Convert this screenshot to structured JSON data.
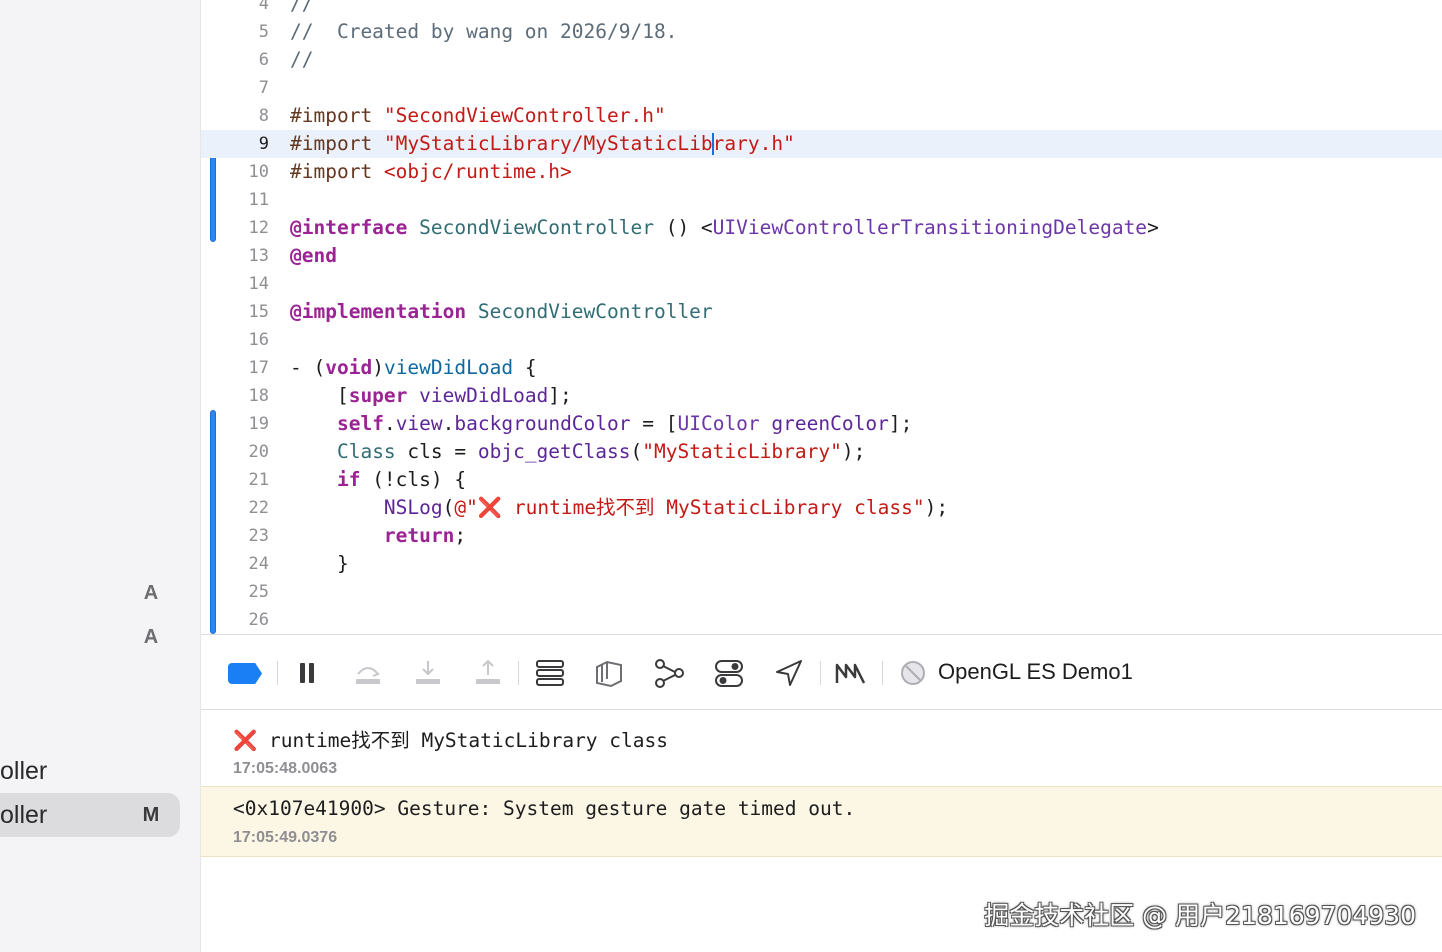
{
  "sidebar": {
    "badges": [
      "A",
      "A"
    ],
    "files": [
      {
        "name": "oller",
        "status": "",
        "selected": false
      },
      {
        "name": "oller",
        "status": "M",
        "selected": true
      }
    ]
  },
  "editor": {
    "current_line": 9,
    "lines": [
      {
        "n": "4",
        "segs": [
          {
            "t": "//",
            "c": "comment"
          }
        ]
      },
      {
        "n": "5",
        "segs": [
          {
            "t": "//  Created by wang on 2026/9/18.",
            "c": "comment"
          }
        ]
      },
      {
        "n": "6",
        "segs": [
          {
            "t": "//",
            "c": "comment"
          }
        ]
      },
      {
        "n": "7",
        "segs": []
      },
      {
        "n": "8",
        "segs": [
          {
            "t": "#import ",
            "c": "preproc"
          },
          {
            "t": "\"SecondViewController.h\"",
            "c": "string"
          }
        ]
      },
      {
        "n": "9",
        "segs": [
          {
            "t": "#import ",
            "c": "preproc"
          },
          {
            "t": "\"MyStaticLibrary/MyStaticLibrary.h\"",
            "c": "string"
          }
        ]
      },
      {
        "n": "10",
        "segs": [
          {
            "t": "#import ",
            "c": "preproc"
          },
          {
            "t": "<objc/runtime.h>",
            "c": "string"
          }
        ]
      },
      {
        "n": "11",
        "segs": []
      },
      {
        "n": "12",
        "segs": [
          {
            "t": "@interface",
            "c": "keyword"
          },
          {
            "t": " ",
            "c": "plain"
          },
          {
            "t": "SecondViewController",
            "c": "typedecl"
          },
          {
            "t": " () <",
            "c": "plain"
          },
          {
            "t": "UIViewControllerTransitioningDelegate",
            "c": "sdktype"
          },
          {
            "t": ">",
            "c": "plain"
          }
        ]
      },
      {
        "n": "13",
        "segs": [
          {
            "t": "@end",
            "c": "keyword"
          }
        ]
      },
      {
        "n": "14",
        "segs": []
      },
      {
        "n": "15",
        "segs": [
          {
            "t": "@implementation",
            "c": "keyword"
          },
          {
            "t": " ",
            "c": "plain"
          },
          {
            "t": "SecondViewController",
            "c": "typedecl"
          }
        ]
      },
      {
        "n": "16",
        "segs": []
      },
      {
        "n": "17",
        "segs": [
          {
            "t": "- (",
            "c": "plain"
          },
          {
            "t": "void",
            "c": "keyword"
          },
          {
            "t": ")",
            "c": "plain"
          },
          {
            "t": "viewDidLoad",
            "c": "funcdecl"
          },
          {
            "t": " {",
            "c": "plain"
          }
        ]
      },
      {
        "n": "18",
        "segs": [
          {
            "t": "    [",
            "c": "plain"
          },
          {
            "t": "super",
            "c": "keyword"
          },
          {
            "t": " ",
            "c": "plain"
          },
          {
            "t": "viewDidLoad",
            "c": "sdkmethod"
          },
          {
            "t": "];",
            "c": "plain"
          }
        ]
      },
      {
        "n": "19",
        "segs": [
          {
            "t": "    ",
            "c": "plain"
          },
          {
            "t": "self",
            "c": "keyword"
          },
          {
            "t": ".",
            "c": "plain"
          },
          {
            "t": "view",
            "c": "sdkmethod"
          },
          {
            "t": ".",
            "c": "plain"
          },
          {
            "t": "backgroundColor",
            "c": "sdkmethod"
          },
          {
            "t": " = [",
            "c": "plain"
          },
          {
            "t": "UIColor",
            "c": "sdktype"
          },
          {
            "t": " ",
            "c": "plain"
          },
          {
            "t": "greenColor",
            "c": "sdkmethod"
          },
          {
            "t": "];",
            "c": "plain"
          }
        ]
      },
      {
        "n": "20",
        "segs": [
          {
            "t": "    ",
            "c": "plain"
          },
          {
            "t": "Class",
            "c": "typedecl"
          },
          {
            "t": " cls = ",
            "c": "plain"
          },
          {
            "t": "objc_getClass",
            "c": "sdkmethod"
          },
          {
            "t": "(",
            "c": "plain"
          },
          {
            "t": "\"MyStaticLibrary\"",
            "c": "string"
          },
          {
            "t": ");",
            "c": "plain"
          }
        ]
      },
      {
        "n": "21",
        "segs": [
          {
            "t": "    ",
            "c": "plain"
          },
          {
            "t": "if",
            "c": "keyword"
          },
          {
            "t": " (!cls) {",
            "c": "plain"
          }
        ]
      },
      {
        "n": "22",
        "segs": [
          {
            "t": "        ",
            "c": "plain"
          },
          {
            "t": "NSLog",
            "c": "sdkmethod"
          },
          {
            "t": "(",
            "c": "plain"
          },
          {
            "t": "@\"",
            "c": "string"
          },
          {
            "t": "❌",
            "c": "errx"
          },
          {
            "t": " runtime找不到 MyStaticLibrary class\"",
            "c": "string"
          },
          {
            "t": ");",
            "c": "plain"
          }
        ]
      },
      {
        "n": "23",
        "segs": [
          {
            "t": "        ",
            "c": "plain"
          },
          {
            "t": "return",
            "c": "keyword"
          },
          {
            "t": ";",
            "c": "plain"
          }
        ]
      },
      {
        "n": "24",
        "segs": [
          {
            "t": "    }",
            "c": "plain"
          }
        ]
      },
      {
        "n": "25",
        "segs": []
      },
      {
        "n": "26",
        "segs": []
      }
    ]
  },
  "colors": {
    "comment": "#5d6c79",
    "preproc": "#643820",
    "string": "#c41a16",
    "keyword": "#9b2393",
    "typedecl": "#326d74",
    "sdktype": "#6c36a9",
    "funcdecl": "#0f68a0",
    "sdkmethod": "#5c2699",
    "plain": "#1d1d1f",
    "errx": "#e0212e",
    "accent": "#1a7ff5"
  },
  "debug_bar": {
    "icons": [
      "breakpoint-toggle-icon",
      "pause-icon",
      "step-over-icon",
      "step-into-icon",
      "step-out-icon",
      "view-hierarchy-icon",
      "memory-graph-icon",
      "environment-overrides-icon",
      "simulate-location-icon",
      "metal-capture-icon",
      "scheme-icon"
    ],
    "scheme": "OpenGL ES Demo1"
  },
  "console": {
    "entries": [
      {
        "icon": "❌",
        "message": "runtime找不到 MyStaticLibrary class",
        "time": "17:05:48.0063",
        "kind": "error"
      },
      {
        "icon": "",
        "message": "<0x107e41900> Gesture: System gesture gate timed out.",
        "time": "17:05:49.0376",
        "kind": "warning"
      }
    ]
  },
  "watermark": "掘金技术社区 @ 用户218169704930"
}
